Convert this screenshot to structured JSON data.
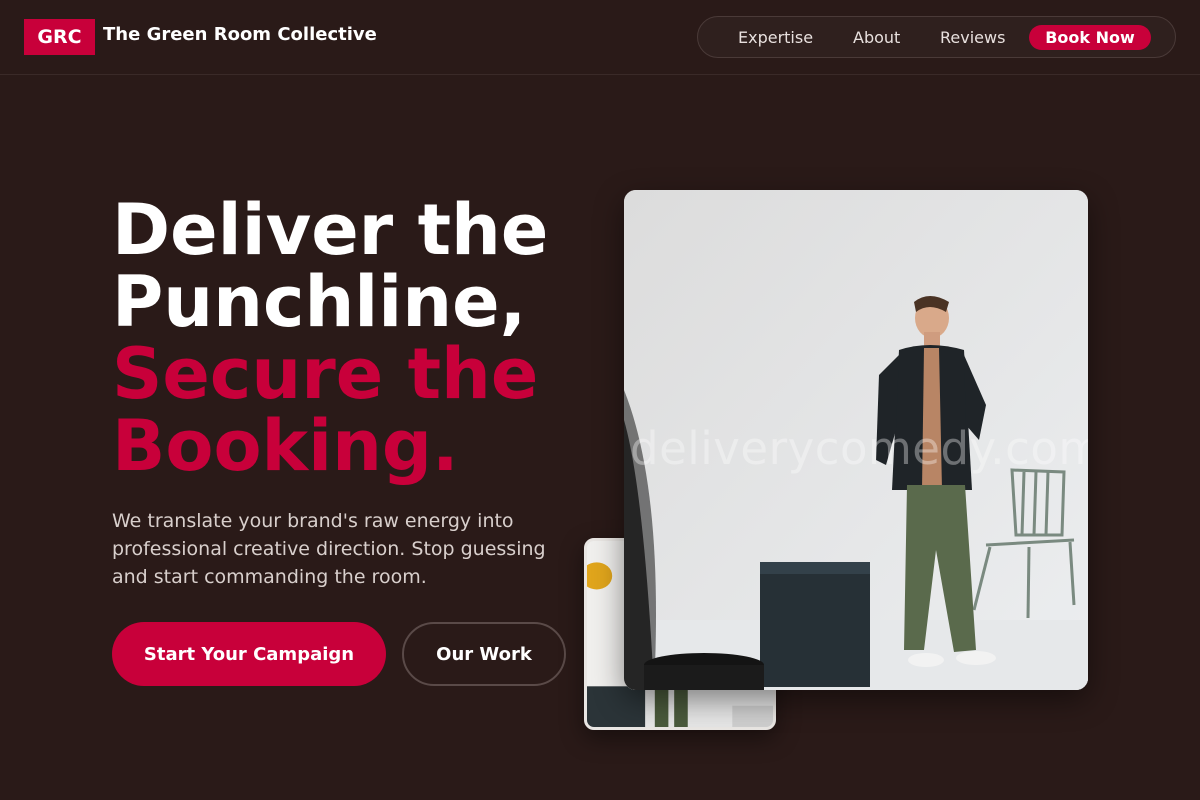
{
  "brand": {
    "logo_text": "GRC",
    "name": "The Green Room Collective"
  },
  "nav": {
    "items": [
      {
        "label": "Expertise"
      },
      {
        "label": "About"
      },
      {
        "label": "Reviews"
      }
    ],
    "cta_label": "Book Now"
  },
  "hero": {
    "headline_white": [
      "Deliver the",
      "Punchline,"
    ],
    "headline_accent": [
      "Secure the",
      "Booking."
    ],
    "subcopy": "We translate your brand's raw energy into professional creative direction. Stop guessing and start commanding the room.",
    "primary_button": "Start Your Campaign",
    "secondary_button": "Our Work"
  },
  "images": {
    "main_photo_watermark": "deliverycomedy.com"
  },
  "colors": {
    "background": "#2a1a18",
    "accent": "#c8003a",
    "text": "#ffffff",
    "muted_text": "#d8cfcc"
  }
}
